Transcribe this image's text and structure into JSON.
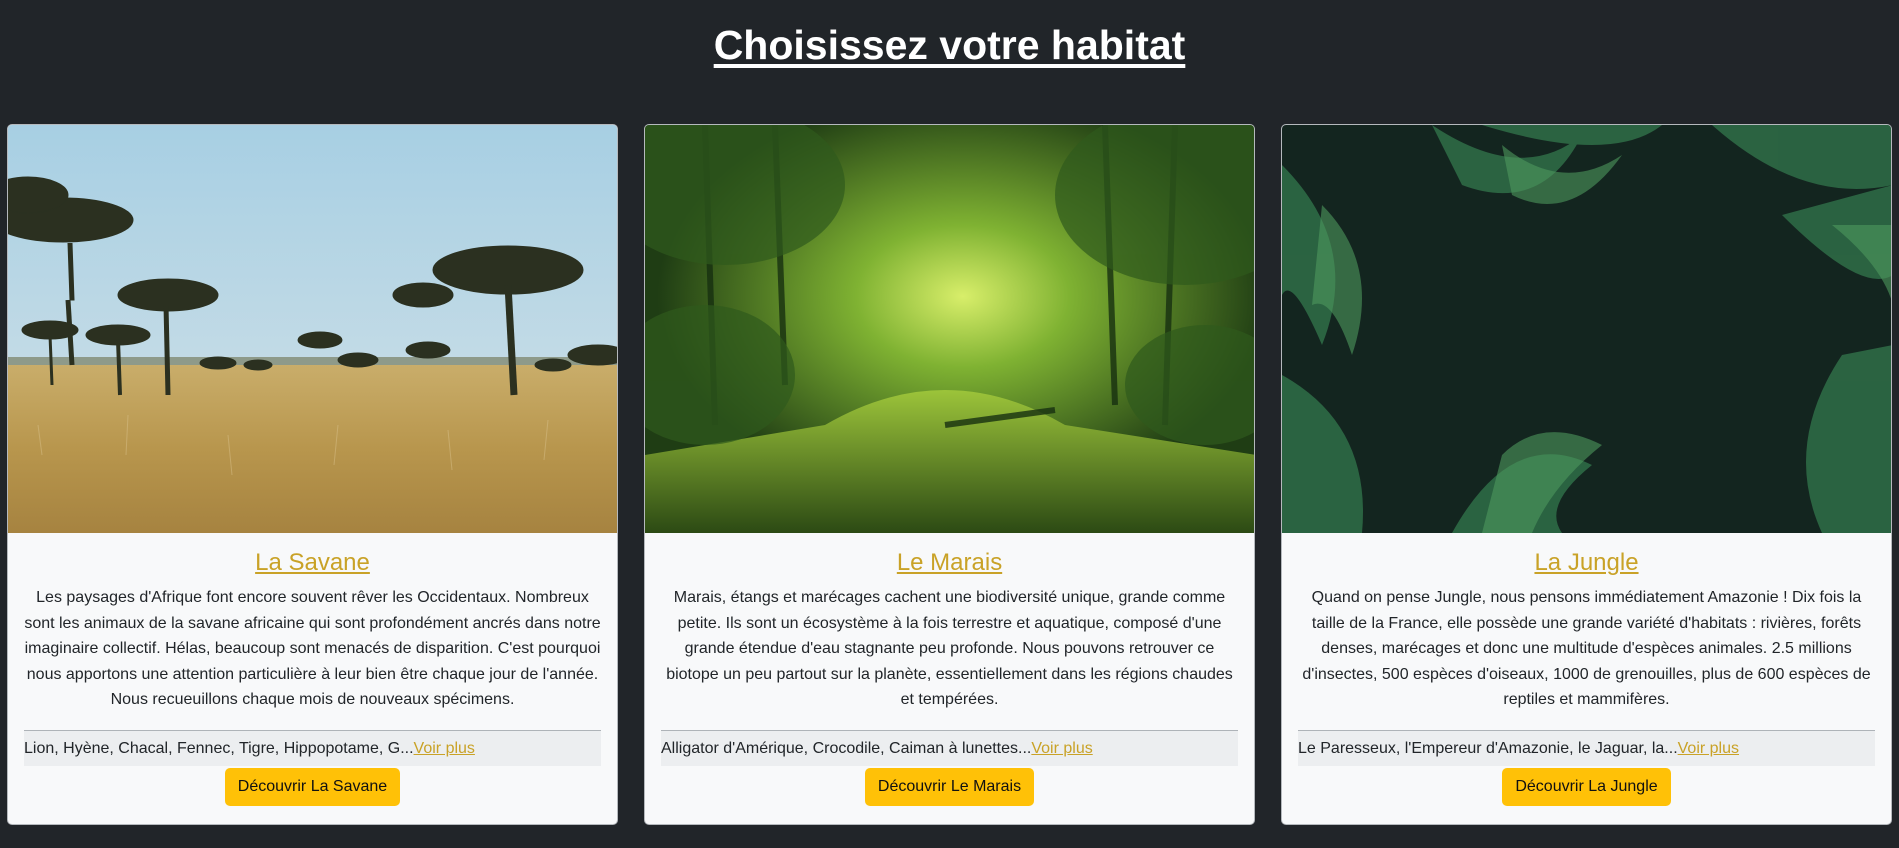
{
  "page": {
    "title": "Choisissez votre habitat"
  },
  "colors": {
    "background": "#212529",
    "card": "#f8f9fa",
    "accent_link": "#c9a227",
    "button": "#ffc107"
  },
  "cards": [
    {
      "title": "La Savane",
      "image": "savanna-landscape-image",
      "text": "Les paysages d'Afrique font encore souvent rêver les Occidentaux. Nombreux sont les animaux de la savane africaine qui sont profondément ancrés dans notre imaginaire collectif. Hélas, beaucoup sont menacés de disparition. C'est pourquoi nous apportons une attention particulière à leur bien être chaque jour de l'année. Nous recueuillons chaque mois de nouveaux spécimens.",
      "species": "Lion, Hyène, Chacal, Fennec, Tigre, Hippopotame, G...",
      "more_link": "Voir plus",
      "button": "Découvrir La Savane"
    },
    {
      "title": "Le Marais",
      "image": "swamp-landscape-image",
      "text": "Marais, étangs et marécages cachent une biodiversité unique, grande comme petite. Ils sont un écosystème à la fois terrestre et aquatique, composé d'une grande étendue d'eau stagnante peu profonde. Nous pouvons retrouver ce biotope un peu partout sur la planète, essentiellement dans les régions chaudes et tempérées.",
      "species": "Alligator d'Amérique, Crocodile, Caiman à lunettes...",
      "more_link": "Voir plus",
      "button": "Découvrir Le Marais"
    },
    {
      "title": "La Jungle",
      "image": "jungle-ferns-image",
      "text": "Quand on pense Jungle, nous pensons immédiatement Amazonie ! Dix fois la taille de la France, elle possède une grande variété d'habitats : rivières, forêts denses, marécages et donc une multitude d'espèces animales. 2.5 millions d'insectes, 500 espèces d'oiseaux, 1000 de grenouilles, plus de 600 espèces de reptiles et mammifères.",
      "species": "Le Paresseux, l'Empereur d'Amazonie, le Jaguar, la...",
      "more_link": "Voir plus",
      "button": "Découvrir La Jungle"
    }
  ]
}
